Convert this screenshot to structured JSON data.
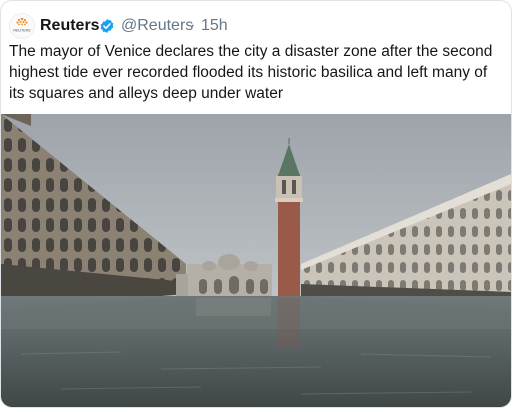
{
  "tweet": {
    "author_name": "Reuters",
    "author_handle": "@Reuters",
    "separator": "·",
    "time": "15h",
    "avatar_label": "REUTERS",
    "text_lines": [
      "The mayor of Venice declares the city a disaster zone after the second",
      "highest tide ever recorded flooded its historic basilica and left many of",
      "its squares and alleys deep under water"
    ]
  },
  "colors": {
    "verified": "#1da1f2",
    "secondary_text": "#657786",
    "primary_text": "#14171a",
    "reuters_orange": "#f28c28"
  },
  "icons": {
    "verified": "verified-badge-icon",
    "avatar": "reuters-logo"
  }
}
